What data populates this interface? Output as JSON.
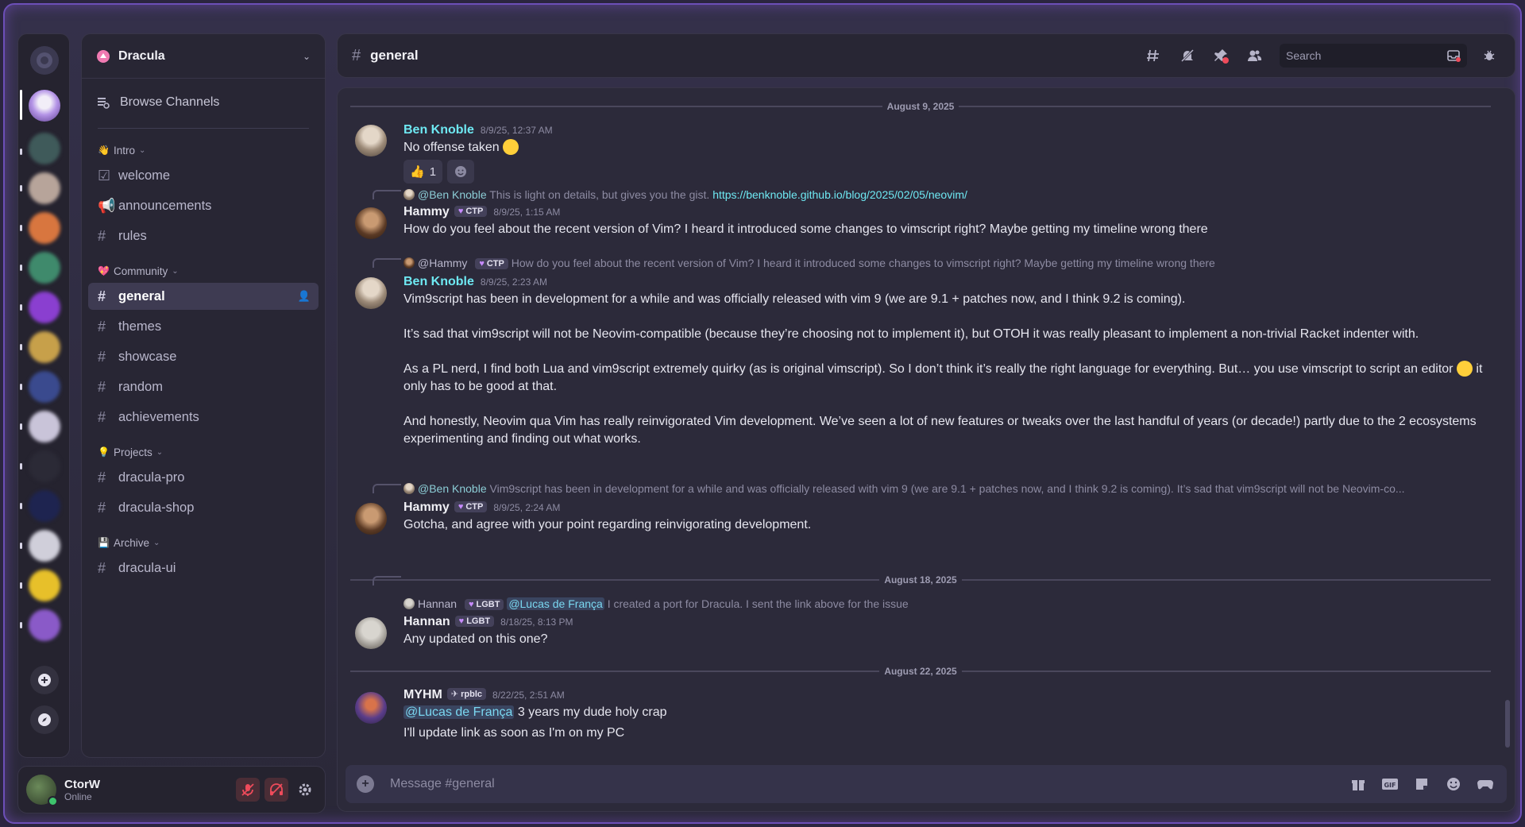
{
  "server": {
    "name": "Dracula"
  },
  "sidebar": {
    "browse_label": "Browse Channels",
    "categories": [
      {
        "emoji": "👋",
        "label": "Intro",
        "channels": [
          "welcome",
          "announcements",
          "rules"
        ]
      },
      {
        "emoji": "💖",
        "label": "Community",
        "channels": [
          "general",
          "themes",
          "showcase",
          "random",
          "achievements"
        ]
      },
      {
        "emoji": "💡",
        "label": "Projects",
        "channels": [
          "dracula-pro",
          "dracula-shop"
        ]
      },
      {
        "emoji": "💾",
        "label": "Archive",
        "channels": [
          "dracula-ui"
        ]
      }
    ]
  },
  "user": {
    "name": "CtorW",
    "status": "Online"
  },
  "channel": {
    "name": "general"
  },
  "search": {
    "placeholder": "Search"
  },
  "composer": {
    "placeholder": "Message #general"
  },
  "dates": [
    "August 9, 2025",
    "August 18, 2025",
    "August 22, 2025"
  ],
  "messages": [
    {
      "author": "Ben Knoble",
      "time": "8/9/25, 12:37 AM",
      "text": "No offense taken",
      "reactions": [
        {
          "emoji": "👍",
          "count": "1"
        }
      ]
    },
    {
      "reply": {
        "who": "@Ben Knoble",
        "text": "This is light on details, but gives you the gist.",
        "link": "https://benknoble.github.io/blog/2025/02/05/neovim/"
      },
      "author": "Hammy",
      "tag": "CTP",
      "time": "8/9/25, 1:15 AM",
      "text": "How do you feel about the recent version of Vim? I heard it introduced some changes to vimscript right? Maybe getting my timeline wrong there"
    },
    {
      "reply": {
        "who": "@Hammy",
        "tag": "CTP",
        "text": "How do you feel about the recent version of Vim? I heard it introduced some changes to vimscript right? Maybe getting my timeline wrong there"
      },
      "author": "Ben Knoble",
      "time": "8/9/25, 2:23 AM",
      "paras": [
        "Vim9script has been in development for a while and was officially released with vim 9 (we are 9.1 + patches now, and I think 9.2 is coming).",
        "It’s sad that vim9script will not be Neovim-compatible (because they’re choosing not to implement it), but OTOH it was really pleasant to implement a non-trivial Racket indenter with.",
        "As a PL nerd, I find both Lua and vim9script extremely quirky (as is original vimscript). So I don’t think it’s really the right language for everything. But… you use vimscript to script an editor",
        "it only has to be good at that.",
        "And honestly, Neovim qua Vim has really reinvigorated Vim development. We’ve seen a lot of new features or tweaks over the last handful of years (or decade!) partly due to the 2 ecosystems experimenting and finding out what works."
      ]
    },
    {
      "reply": {
        "who": "@Ben Knoble",
        "text": "Vim9script has been in development for a while and was officially released with vim 9 (we are 9.1 + patches now, and I think 9.2 is coming).  It’s sad that vim9script will not be Neovim-co..."
      },
      "author": "Hammy",
      "tag": "CTP",
      "time": "8/9/25, 2:24 AM",
      "text": "Gotcha, and agree with your point regarding reinvigorating development."
    },
    {
      "reply": {
        "who": "Hannan",
        "tag": "LGBT",
        "mention": "@Lucas de França",
        "text": "I created a port for Dracula. I sent the link above for the issue"
      },
      "author": "Hannan",
      "tag": "LGBT",
      "time": "8/18/25, 8:13 PM",
      "text": "Any updated on this one?"
    },
    {
      "author": "MYHM",
      "tag": "rpblc",
      "time": "8/22/25, 2:51 AM",
      "mention": "@Lucas de França",
      "text": "3 years my dude holy crap",
      "text2": "I'll update link as soon as I'm on my PC"
    }
  ],
  "colors": {
    "accent_cyan": "#6ee8f2",
    "frame_purple": "#6c4fb8",
    "online_green": "#3ec46d",
    "danger_red": "#ee4b5b"
  }
}
